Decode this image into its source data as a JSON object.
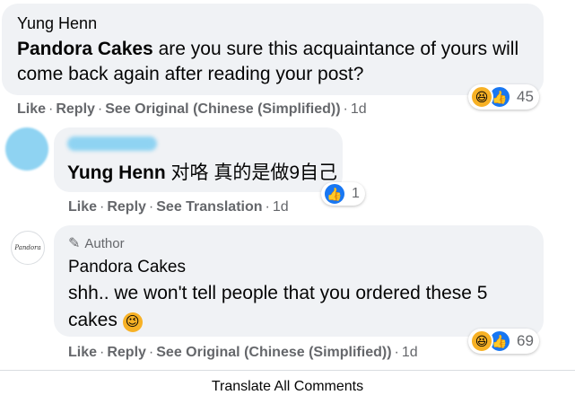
{
  "comment1": {
    "author": "Yung Henn",
    "mention": "Pandora Cakes",
    "text": " are you sure this acquaintance of yours will come back again after reading your post?",
    "actions": {
      "like": "Like",
      "reply": "Reply",
      "see_original": "See Original (Chinese (Simplified))",
      "time": "1d"
    },
    "reactions": {
      "icons": [
        "haha-icon",
        "like-icon"
      ],
      "count": "45"
    }
  },
  "comment2": {
    "mention": "Yung Henn",
    "text": " 对咯 真的是做9自己",
    "actions": {
      "like": "Like",
      "reply": "Reply",
      "see_translation": "See Translation",
      "time": "1d"
    },
    "reactions": {
      "icons": [
        "like-icon"
      ],
      "count": "1"
    }
  },
  "comment3": {
    "badge": "Author",
    "author": "Pandora Cakes",
    "avatar_text": "Pandora",
    "text": "shh.. we won't tell people that you ordered these 5 cakes",
    "emoji": "😉",
    "actions": {
      "like": "Like",
      "reply": "Reply",
      "see_original": "See Original (Chinese (Simplified))",
      "time": "1d"
    },
    "reactions": {
      "icons": [
        "haha-icon",
        "like-icon"
      ],
      "count": "69"
    }
  },
  "footer": {
    "translate_all": "Translate All Comments"
  },
  "colors": {
    "bubble": "#f0f2f5",
    "like_blue": "#1877f2",
    "haha_yellow": "#f7b125",
    "meta_gray": "#65676b",
    "redact_blue": "#8fd3f2"
  }
}
